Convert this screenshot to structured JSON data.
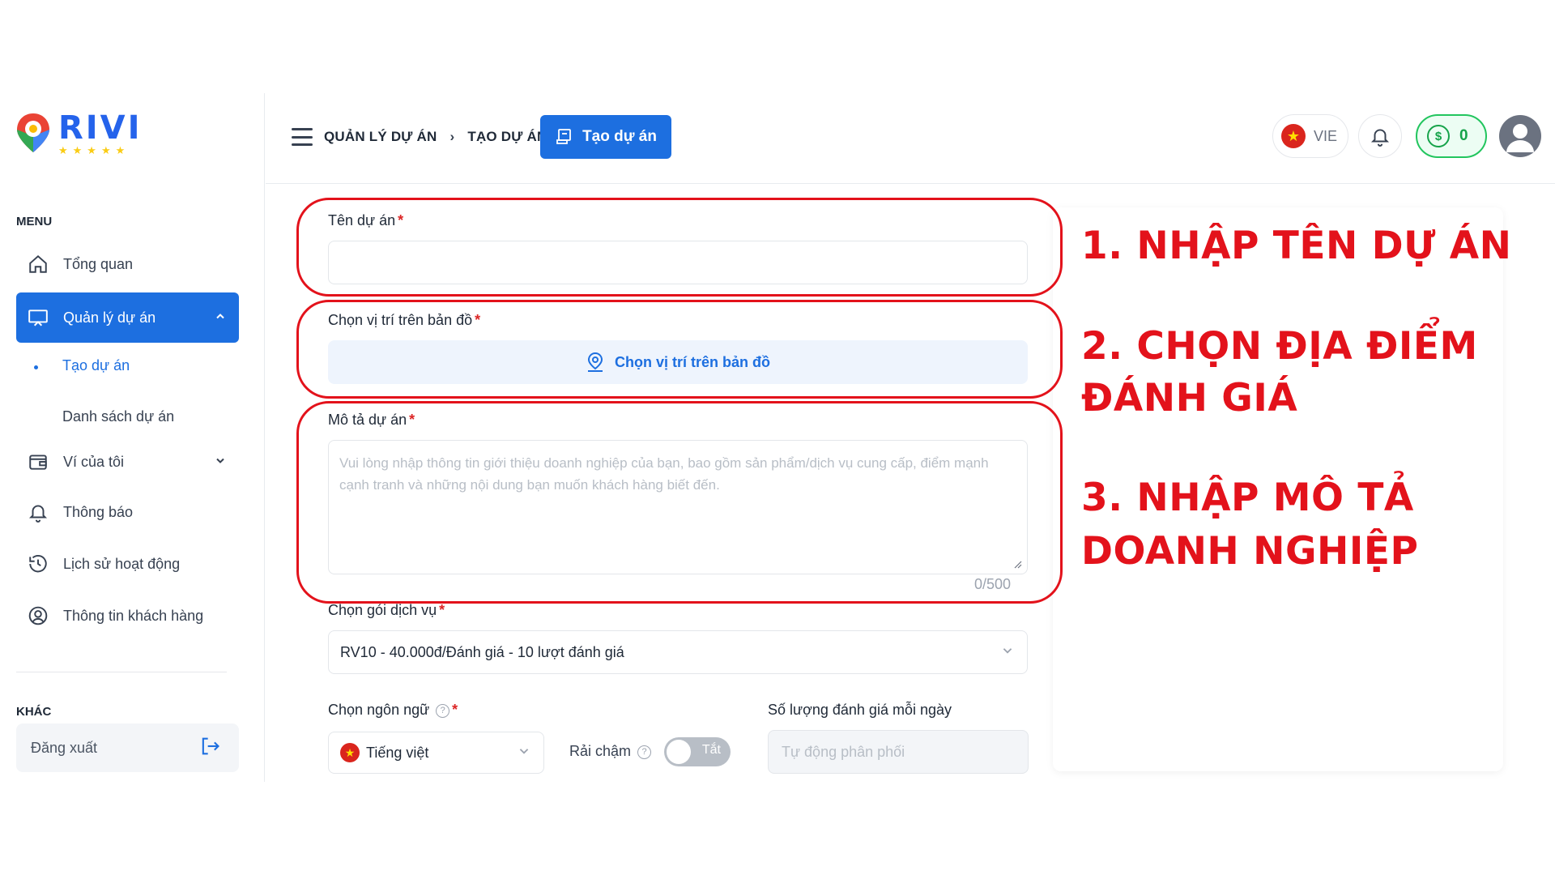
{
  "brand": {
    "name": "RIVI",
    "stars": "★★★★★"
  },
  "sidebar": {
    "menu_heading": "MENU",
    "items": [
      {
        "label": "Tổng quan",
        "icon": "home-icon"
      },
      {
        "label": "Quản lý dự án",
        "icon": "monitor-icon"
      },
      {
        "label": "Ví của tôi",
        "icon": "wallet-icon"
      },
      {
        "label": "Thông báo",
        "icon": "bell-icon"
      },
      {
        "label": "Lịch sử hoạt động",
        "icon": "history-icon"
      },
      {
        "label": "Thông tin khách hàng",
        "icon": "user-circle-icon"
      }
    ],
    "sub_items": [
      {
        "label": "Tạo dự án"
      },
      {
        "label": "Danh sách dự án"
      }
    ],
    "other_heading": "KHÁC",
    "logout_label": "Đăng xuất"
  },
  "header": {
    "breadcrumb": [
      "QUẢN LÝ DỰ ÁN",
      "TẠO DỰ ÁN"
    ],
    "create_button": "Tạo dự án",
    "language": "VIE",
    "balance": "0",
    "coin_symbol": "$"
  },
  "form": {
    "project_name_label": "Tên dự án",
    "project_name_value": "",
    "map_label": "Chọn vị trí trên bản đồ",
    "map_button": "Chọn vị trí trên bản đồ",
    "description_label": "Mô tả dự án",
    "description_placeholder": "Vui lòng nhập thông tin giới thiệu doanh nghiệp của bạn, bao gồm sản phẩm/dịch vụ cung cấp, điểm mạnh cạnh tranh và những nội dung bạn muốn khách hàng biết đến.",
    "description_counter": "0/500",
    "package_label": "Chọn gói dịch vụ",
    "package_value": "RV10 - 40.000đ/Đánh giá - 10 lượt đánh giá",
    "language_label": "Chọn ngôn ngữ",
    "language_value": "Tiếng việt",
    "slow_label": "Rải chậm",
    "slow_toggle": "Tắt",
    "daily_label": "Số lượng đánh giá mỗi ngày",
    "daily_placeholder": "Tự động phân phối"
  },
  "annotations": {
    "step1": "1. NHẬP TÊN DỰ ÁN",
    "step2_line1": "2. CHỌN ĐỊA ĐIỂM",
    "step2_line2": "ĐÁNH GIÁ",
    "step3_line1": "3. NHẬP MÔ TẢ",
    "step3_line2": "DOANH NGHIỆP"
  },
  "colors": {
    "primary": "#1d6fe0",
    "annotation": "#e3121b",
    "coin": "#16a34a"
  }
}
